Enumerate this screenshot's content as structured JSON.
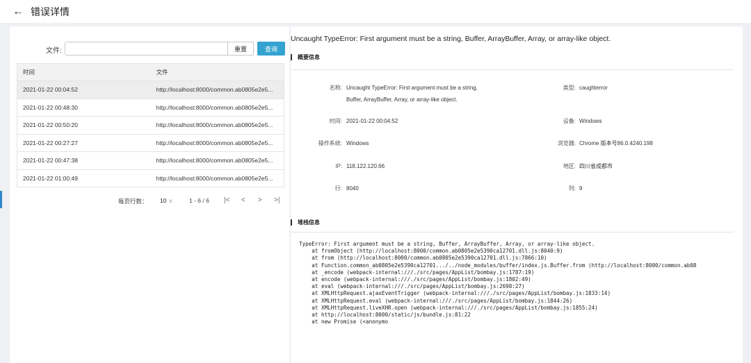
{
  "header": {
    "title": "错误详情"
  },
  "filter": {
    "label": "文件:",
    "value": "",
    "placeholder": "",
    "reset_label": "重置",
    "query_label": "查询"
  },
  "table": {
    "columns": [
      "时间",
      "文件"
    ],
    "rows": [
      {
        "time": "2021-01-22 00:04:52",
        "file": "http://localhost:8000/common.ab0805e2e5..."
      },
      {
        "time": "2021-01-22 00:48:30",
        "file": "http://localhost:8000/common.ab0805e2e5..."
      },
      {
        "time": "2021-01-22 00:50:20",
        "file": "http://localhost:8000/common.ab0805e2e5..."
      },
      {
        "time": "2021-01-22 00:27:27",
        "file": "http://localhost:8000/common.ab0805e2e5..."
      },
      {
        "time": "2021-01-22 00:47:38",
        "file": "http://localhost:8000/common.ab0805e2e5..."
      },
      {
        "time": "2021-01-22 01:00:49",
        "file": "http://localhost:8000/common.ab0805e2e5..."
      }
    ]
  },
  "pager": {
    "rows_label": "每页行数：",
    "rows_value": "10",
    "range": "1 - 6 / 6",
    "first": "|<",
    "prev": "<",
    "next": ">",
    "last": ">|"
  },
  "detail": {
    "title": "Uncaught TypeError: First argument must be a string, Buffer, ArrayBuffer, Array, or array-like object.",
    "summary_heading": "概要信息",
    "fields": {
      "name_label": "名称:",
      "name_line1": "Uncaught TypeError: First argument must be a string,",
      "name_line2": "Buffer, ArrayBuffer, Array, or array-like object.",
      "type_label": "类型:",
      "type_value": "caughterror",
      "time_label": "时间:",
      "time_value": "2021-01-22 00:04:52",
      "device_label": "设备:",
      "device_value": "Windows",
      "os_label": "操作系统:",
      "os_value": "Windows",
      "browser_label": "浏览器:",
      "browser_value": "Chrome 版本号86.0.4240.198",
      "ip_label": "IP:",
      "ip_value": "118.122.120.66",
      "region_label": "地区:",
      "region_value": "四川省成都市",
      "row_label": "行:",
      "row_value": "8040",
      "col_label": "列:",
      "col_value": "9"
    },
    "stack_heading": "堆栈信息",
    "stack_lines": [
      "TypeError: First argument must be a string, Buffer, ArrayBuffer, Array, or array-like object.",
      "    at fromObject (http://localhost:8000/common.ab0805e2e5390ca12701.dll.js:8040:9)",
      "    at from (http://localhost:8000/common.ab0805e2e5390ca12701.dll.js:7866:10)",
      "    at Function.common_ab0805e2e5390ca12701.../../node_modules/buffer/index.js.Buffer.from (http://localhost:8000/common.ab08",
      "    at _encode (webpack-internal:///./src/pages/AppList/bombay.js:1787:19)",
      "    at encode (webpack-internal:///./src/pages/AppList/bombay.js:1802:49)",
      "    at eval (webpack-internal:///./src/pages/AppList/bombay.js:2698:27)",
      "    at XMLHttpRequest.ajaxEventTrigger (webpack-internal:///./src/pages/AppList/bombay.js:1833:14)",
      "    at XMLHttpRequest.eval (webpack-internal:///./src/pages/AppList/bombay.js:1844:26)",
      "    at XMLHttpRequest.liveXHR.open (webpack-internal:///./src/pages/AppList/bombay.js:1855:24)",
      "    at http://localhost:8000/static/js/bundle.js:81:22",
      "    at new Promise (<anonymo"
    ]
  }
}
